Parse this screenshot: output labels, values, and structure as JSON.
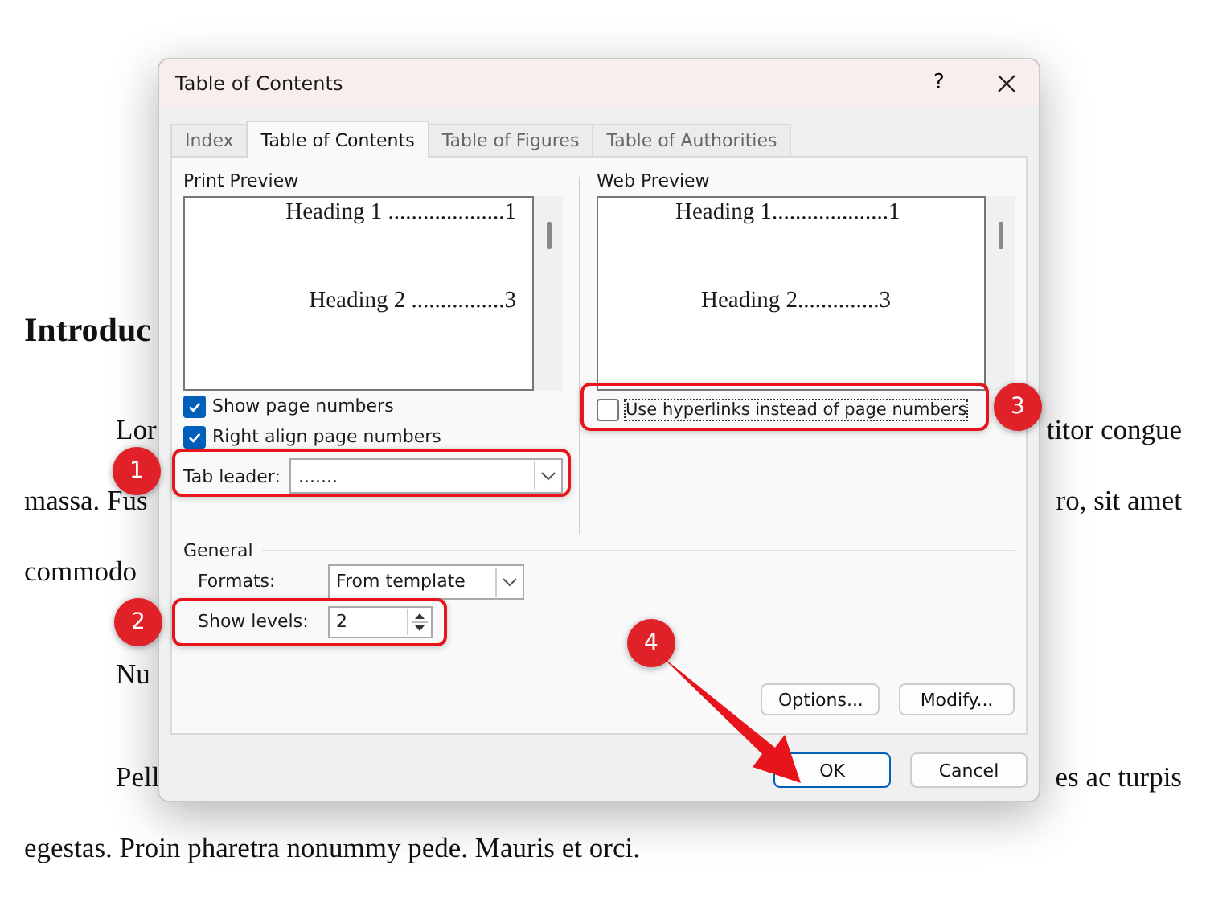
{
  "document": {
    "heading": "Introduc",
    "lines": [
      {
        "kind": "indented",
        "left": "Lor",
        "right": "titor congue"
      },
      {
        "kind": "plain",
        "left": "massa. Fus",
        "right": "ro, sit amet"
      },
      {
        "kind": "plain",
        "left": "commodo"
      },
      {
        "kind": "indented",
        "left": "Nu"
      },
      {
        "kind": "indented",
        "left": "Pell",
        "right": "es ac turpis"
      },
      {
        "kind": "plain",
        "left": "egestas. Proin pharetra nonummy pede. Mauris et orci."
      }
    ]
  },
  "window": {
    "title": "Table of Contents",
    "help": "?"
  },
  "tabs": [
    {
      "label": "Index",
      "selected": false
    },
    {
      "label": "Table of Contents",
      "selected": true
    },
    {
      "label": "Table of Figures",
      "selected": false
    },
    {
      "label": "Table of Authorities",
      "selected": false
    }
  ],
  "print_preview": {
    "title": "Print Preview",
    "entries": [
      "Heading 1 ....................1",
      "Heading 2 ................3"
    ],
    "options": [
      {
        "label": "Show page numbers",
        "checked": true
      },
      {
        "label": "Right align page numbers",
        "checked": true
      }
    ],
    "tab_leader": {
      "label": "Tab leader:",
      "value": "......."
    }
  },
  "web_preview": {
    "title": "Web Preview",
    "entries": [
      "Heading 1....................1",
      "Heading 2..............3"
    ],
    "option": {
      "label": "Use hyperlinks instead of page numbers",
      "checked": false
    }
  },
  "general": {
    "title": "General",
    "formats": {
      "label": "Formats:",
      "value": "From template"
    },
    "show_levels": {
      "label": "Show levels:",
      "value": "2"
    }
  },
  "panel_buttons": [
    "Options...",
    "Modify..."
  ],
  "buttons": [
    "OK",
    "Cancel"
  ],
  "annotations": [
    "1",
    "2",
    "3",
    "4"
  ]
}
